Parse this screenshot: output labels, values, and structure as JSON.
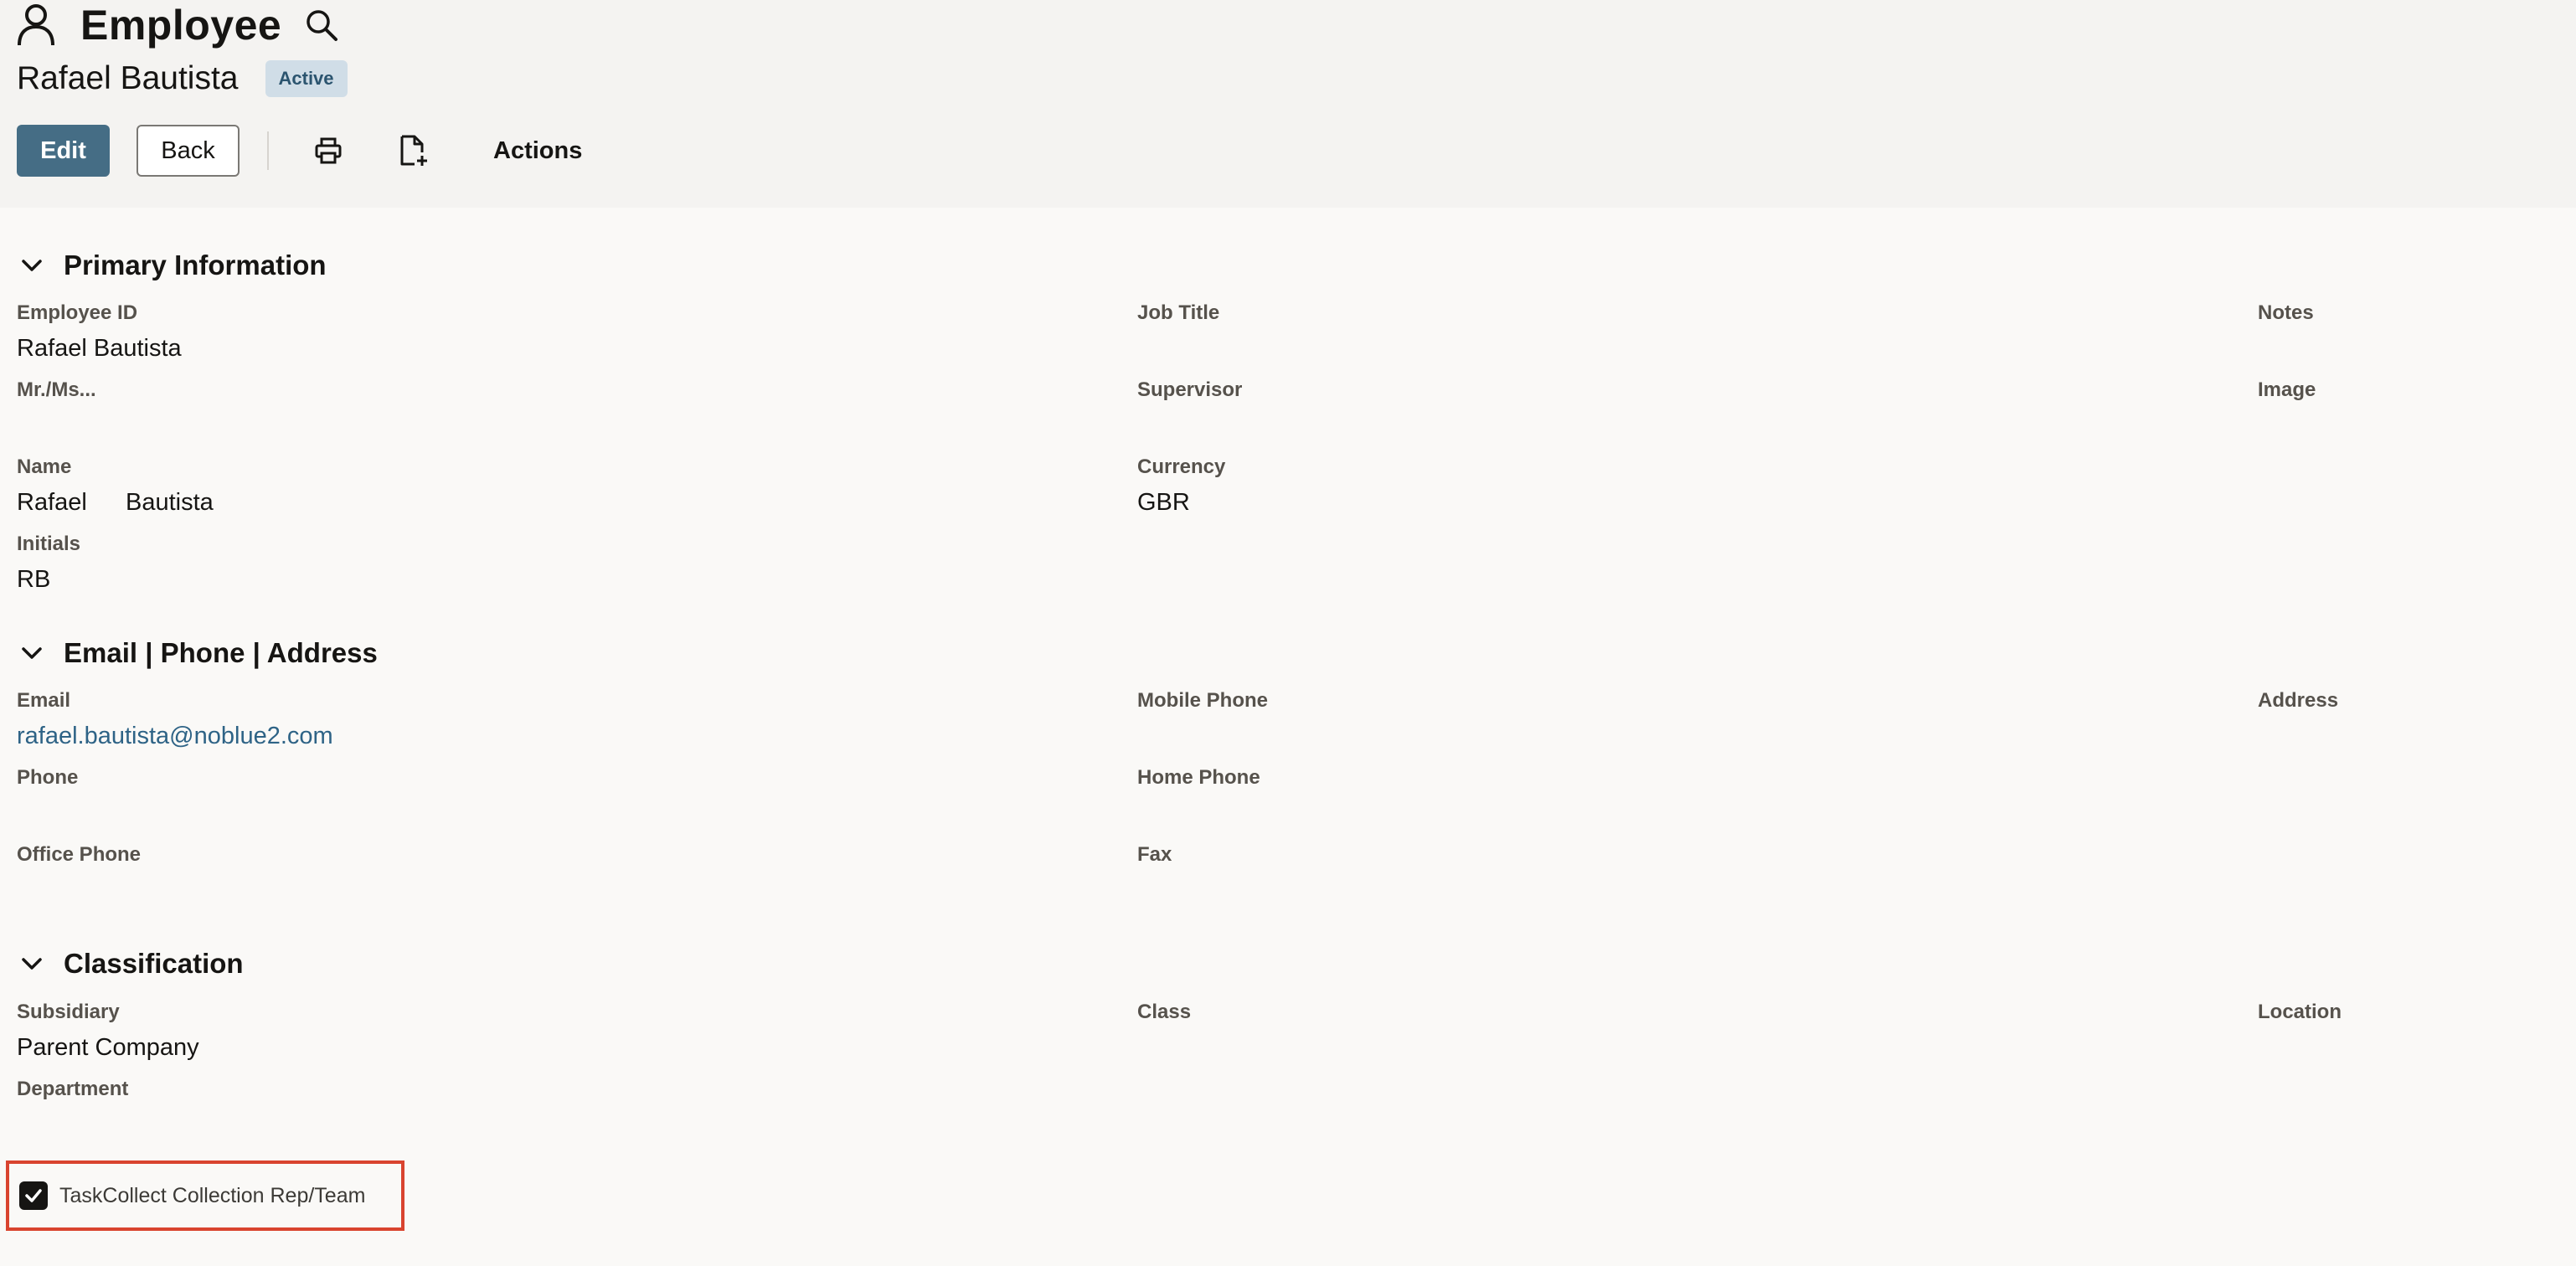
{
  "header": {
    "page_title": "Employee",
    "record_name": "Rafael Bautista",
    "status": "Active"
  },
  "toolbar": {
    "edit_label": "Edit",
    "back_label": "Back",
    "actions_label": "Actions"
  },
  "icons": {
    "title": "person-icon",
    "search": "search-icon",
    "print": "printer-icon",
    "new_document": "new-document-icon",
    "collapse": "chevron-down-icon",
    "checkbox": "checkmark-icon"
  },
  "colors": {
    "primary_button": "#456d85",
    "badge_bg": "#d0dde7",
    "badge_text": "#2b546f",
    "link": "#2e6386",
    "highlight_border": "#d9442f"
  },
  "sections": {
    "primary": {
      "title": "Primary Information",
      "employee_id_label": "Employee ID",
      "employee_id_value": "Rafael Bautista",
      "mr_ms_label": "Mr./Ms...",
      "name_label": "Name",
      "first_name": "Rafael",
      "last_name": "Bautista",
      "initials_label": "Initials",
      "initials_value": "RB",
      "job_title_label": "Job Title",
      "supervisor_label": "Supervisor",
      "currency_label": "Currency",
      "currency_value": "GBR",
      "notes_label": "Notes",
      "image_label": "Image"
    },
    "contact": {
      "title": "Email | Phone | Address",
      "email_label": "Email",
      "email_value": "rafael.bautista@noblue2.com",
      "phone_label": "Phone",
      "office_phone_label": "Office Phone",
      "mobile_phone_label": "Mobile Phone",
      "home_phone_label": "Home Phone",
      "fax_label": "Fax",
      "address_label": "Address"
    },
    "classification": {
      "title": "Classification",
      "subsidiary_label": "Subsidiary",
      "subsidiary_value": "Parent Company",
      "department_label": "Department",
      "class_label": "Class",
      "location_label": "Location"
    }
  },
  "taskcollect": {
    "label": "TaskCollect Collection Rep/Team",
    "checked": true
  }
}
